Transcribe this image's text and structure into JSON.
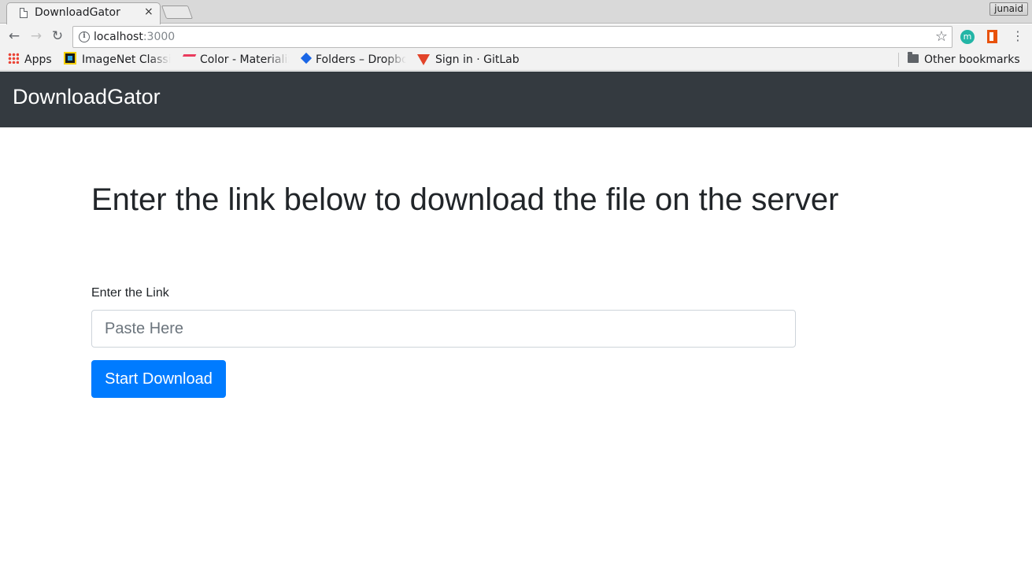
{
  "browser": {
    "tab": {
      "title": "DownloadGator",
      "close_glyph": "×"
    },
    "profile": "junaid",
    "nav": {
      "back": "←",
      "forward": "→",
      "reload": "↻"
    },
    "address": {
      "host": "localhost",
      "port": ":3000"
    },
    "star_glyph": "☆",
    "extension_m_letter": "m",
    "menu_glyph": "⋮",
    "bookmarks": [
      {
        "label": "Apps",
        "icon": "apps-icon"
      },
      {
        "label": "ImageNet Classi",
        "icon": "imagenet-icon"
      },
      {
        "label": "Color - Materializ",
        "icon": "materialize-icon"
      },
      {
        "label": "Folders – Dropbo",
        "icon": "dropbox-icon"
      },
      {
        "label": "Sign in · GitLab",
        "icon": "gitlab-icon"
      }
    ],
    "other_bookmarks": {
      "label": "Other bookmarks",
      "icon": "folder-icon"
    }
  },
  "navbar": {
    "brand": "DownloadGator",
    "color": "#343a40"
  },
  "main": {
    "heading": "Enter the link below to download the file on the server",
    "field_label": "Enter the Link",
    "input": {
      "placeholder": "Paste Here",
      "value": ""
    },
    "submit_label": "Start Download",
    "accent": "#007bff"
  }
}
